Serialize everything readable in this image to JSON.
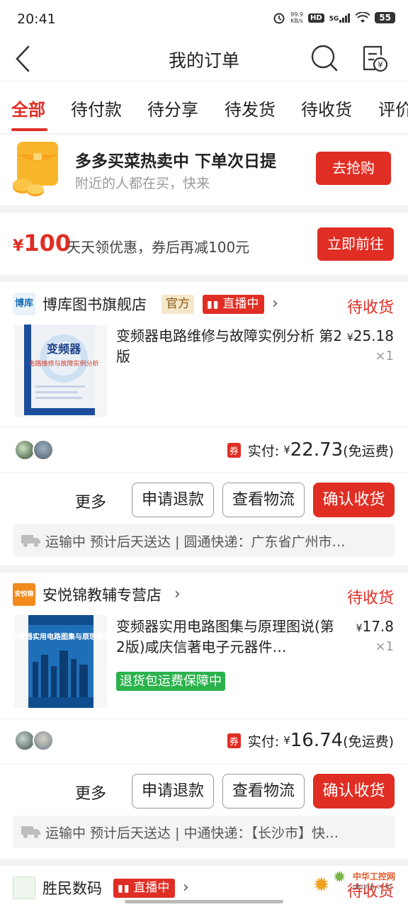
{
  "status_bar": {
    "time": "20:41",
    "net_speed_value": "99.9",
    "net_speed_unit": "KB/s",
    "hd": "HD",
    "signal": "5G",
    "battery": "55"
  },
  "nav": {
    "title": "我的订单"
  },
  "tabs": [
    "全部",
    "待付款",
    "待分享",
    "待发货",
    "待收货",
    "评价"
  ],
  "promo": {
    "headline": "多多买菜热卖中 下单次日提",
    "sub": "附近的人都在买，快来",
    "button": "去抢购"
  },
  "coupon": {
    "currency": "¥",
    "amount": "100",
    "desc": "天天领优惠，券后再减100元",
    "button": "立即前往"
  },
  "orders": [
    {
      "store_logo": "博库",
      "store": "博库图书旗舰店",
      "official_badge": "官方",
      "live_badge": "直播中",
      "status": "待收货",
      "product_title": "变频器电路维修与故障实例分析 第2版",
      "product_price_symbol": "¥",
      "product_price": "25.18",
      "qty": "×1",
      "coupon_badge": "券",
      "paid_label": "实付:",
      "paid_symbol": "¥",
      "paid_amount": "22.73",
      "shipping_fee": "(免运费)",
      "more": "更多",
      "refund_button": "申请退款",
      "logistics_button": "查看物流",
      "confirm_button": "确认收货",
      "shipping_info": "运输中 预计后天送达 | 圆通快递：广东省广州市…"
    },
    {
      "store_logo": "安悦锦",
      "store": "安悦锦教辅专营店",
      "status": "待收货",
      "product_title": "变频器实用电路图集与原理图说(第2版)咸庆信著电子元器件…",
      "product_price_symbol": "¥",
      "product_price": "17.8",
      "qty": "×1",
      "guarantee": "退货包运费保障中",
      "coupon_badge": "券",
      "paid_label": "实付:",
      "paid_symbol": "¥",
      "paid_amount": "16.74",
      "shipping_fee": "(免运费)",
      "more": "更多",
      "refund_button": "申请退款",
      "logistics_button": "查看物流",
      "confirm_button": "确认收货",
      "shipping_info": "运输中 预计后天送达 | 中通快递：【长沙市】快…"
    },
    {
      "store": "胜民数码",
      "live_badge": "直播中",
      "status": "待收货"
    }
  ],
  "book1_cover": {
    "title": "变频器",
    "subtitle": "电路维修与故障实例分析"
  },
  "book2_cover": {
    "title": "变频器实用电路图集与原理图说"
  },
  "watermark": {
    "line1": "中华工控网",
    "line2": "gkong.com"
  },
  "colors": {
    "accent": "#e02e24",
    "green": "#2bb24c",
    "official_bg": "#f5e7c9"
  }
}
